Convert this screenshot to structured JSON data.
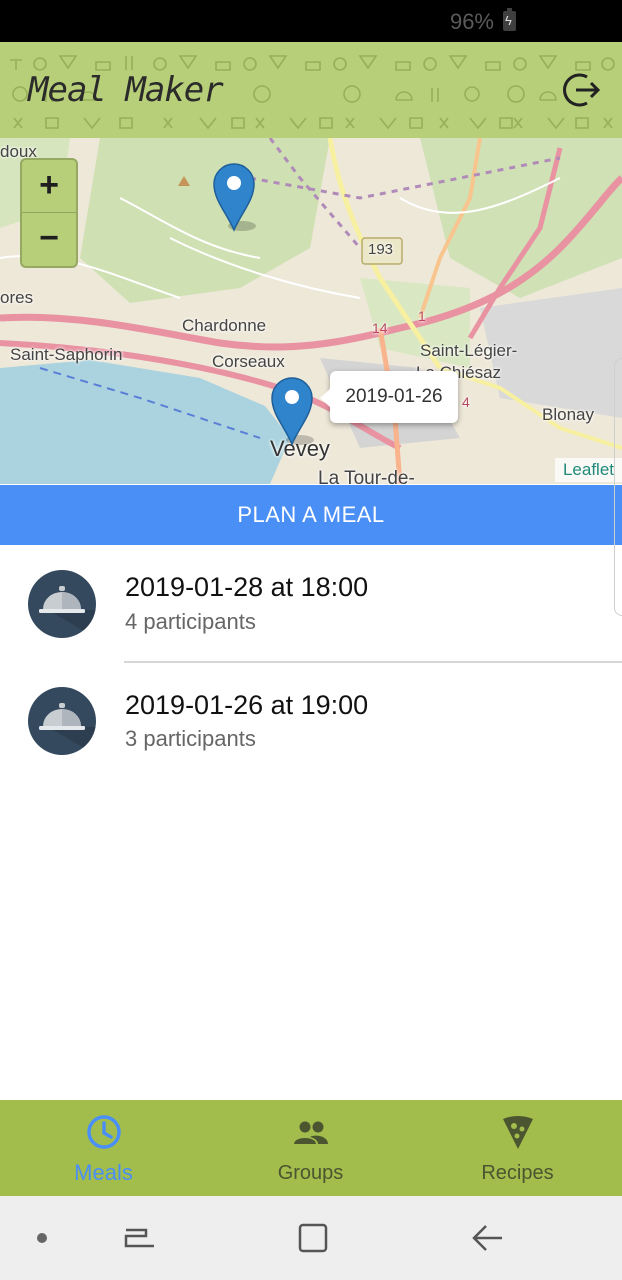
{
  "status_bar": {
    "battery": "96%"
  },
  "header": {
    "title": "Meal Maker",
    "logout_icon": "logout-icon"
  },
  "map": {
    "zoom_in": "+",
    "zoom_out": "−",
    "popup": "2019-01-26",
    "attribution": "Leaflet",
    "labels": {
      "doux": "doux",
      "ores": "ores",
      "chardonne": "Chardonne",
      "saint_saphorin": "Saint-Saphorin",
      "corseaux": "Corseaux",
      "saint_legier": "Saint-Légier-",
      "la_chiesaz": "La Chiésaz",
      "blonay": "Blonay",
      "vevey": "Vevey",
      "la_tour_de": "La Tour-de-",
      "road_193": "193",
      "road_14": "14",
      "road_1": "1",
      "road_4": "4"
    }
  },
  "plan_button": "PLAN A MEAL",
  "meals": [
    {
      "title": "2019-01-28 at 18:00",
      "participants": "4 participants",
      "icon": "cloche-icon"
    },
    {
      "title": "2019-01-26 at 19:00",
      "participants": "3 participants",
      "icon": "cloche-icon"
    }
  ],
  "bottom_nav": {
    "tabs": [
      {
        "label": "Meals",
        "icon": "clock-icon",
        "active": true
      },
      {
        "label": "Groups",
        "icon": "people-icon",
        "active": false
      },
      {
        "label": "Recipes",
        "icon": "pizza-icon",
        "active": false
      }
    ]
  },
  "colors": {
    "accent": "#4a8ff6",
    "header": "#b7cf78",
    "nav": "#a2bd4c"
  }
}
